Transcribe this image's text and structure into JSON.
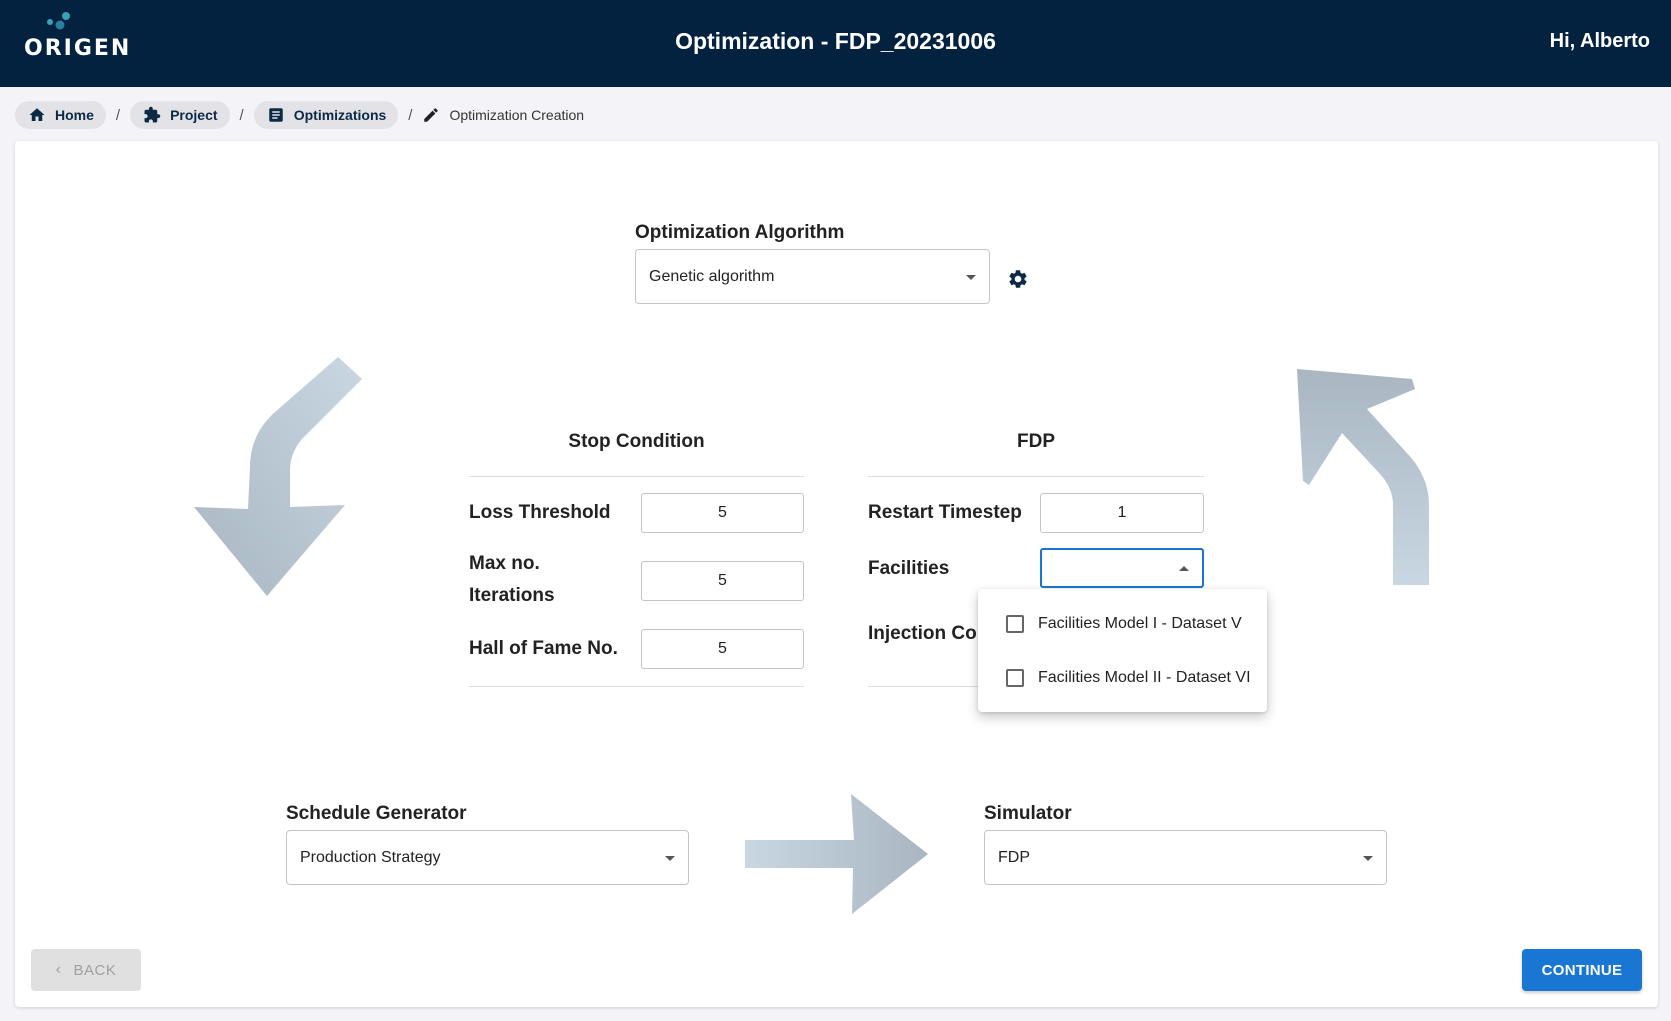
{
  "header": {
    "logo_text": "ORIGEN",
    "title": "Optimization - FDP_20231006",
    "greeting": "Hi, Alberto"
  },
  "breadcrumb": {
    "items": [
      {
        "label": "Home",
        "icon": "home-icon"
      },
      {
        "label": "Project",
        "icon": "puzzle-icon"
      },
      {
        "label": "Optimizations",
        "icon": "document-icon"
      }
    ],
    "separator": "/",
    "current": {
      "label": "Optimization Creation",
      "icon": "pencil-icon"
    }
  },
  "algorithm": {
    "label": "Optimization Algorithm",
    "value": "Genetic algorithm",
    "settings_icon": "gear-icon"
  },
  "stop_condition": {
    "title": "Stop Condition",
    "rows": [
      {
        "label": "Loss Threshold",
        "value": "5"
      },
      {
        "label_line1": "Max no.",
        "label_line2": "Iterations",
        "value": "5"
      },
      {
        "label": "Hall of Fame No.",
        "value": "5"
      }
    ]
  },
  "fdp": {
    "title": "FDP",
    "restart_label": "Restart Timestep",
    "restart_value": "1",
    "facilities_label": "Facilities",
    "facilities_value": "",
    "injection_label": "Injection Co",
    "facilities_options": [
      {
        "label": "Facilities Model I - Dataset V",
        "checked": false
      },
      {
        "label": "Facilities Model II - Dataset VI",
        "checked": false
      }
    ]
  },
  "schedule_generator": {
    "label": "Schedule Generator",
    "value": "Production Strategy"
  },
  "simulator": {
    "label": "Simulator",
    "value": "FDP"
  },
  "actions": {
    "back_label": "BACK",
    "continue_label": "CONTINUE"
  },
  "colors": {
    "header_bg": "#022240",
    "primary": "#1976d2",
    "arrow_dark": "#a9b6c2",
    "arrow_light": "#c9d7e2"
  }
}
